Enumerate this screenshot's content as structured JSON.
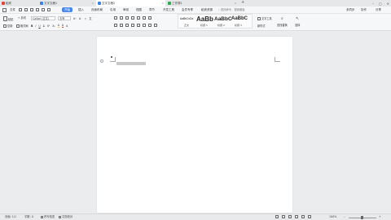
{
  "tabs": [
    {
      "label": "稻壳",
      "color": "#e2453c"
    },
    {
      "label": "文字文稿1",
      "color": "#3f7fe0"
    },
    {
      "label": "文字文稿2",
      "color": "#3f7fe0"
    },
    {
      "label": "工作簿1",
      "color": "#2ea94f"
    }
  ],
  "new_tab_icon": "plus-icon",
  "window_controls": [
    "minimize-icon",
    "maximize-icon",
    "close-icon"
  ],
  "menu": {
    "file": "文件",
    "start": "开始",
    "insert": "插入",
    "page_layout": "页面布局",
    "references": "引用",
    "review": "审阅",
    "view": "视图",
    "chapter": "章节",
    "dev_tools": "开发工具",
    "member": "会员专享",
    "docs_helper": "稻壳资源",
    "search_placeholder": "查找命令、搜索模板",
    "unsynced": "未同步",
    "collab": "协作",
    "share": "分享",
    "active_color": "#4a86e8"
  },
  "ribbon": {
    "paste": "粘贴",
    "cut": "剪切",
    "copy": "复制",
    "format_painter": "格式刷",
    "font_name": "Calibri (正文)",
    "font_size": "五号",
    "bold": "B",
    "italic": "I",
    "underline": "U",
    "styles": [
      {
        "preview": "AaBbCcDd",
        "label": "正文"
      },
      {
        "preview": "AaBb",
        "label": "标题 1"
      },
      {
        "preview": "AaBbC",
        "label": "标题 2"
      },
      {
        "preview": "AaBbC",
        "label": "标题 3"
      }
    ],
    "new_style": "新样式",
    "text_tools": "文字工具",
    "find_replace": "查找替换",
    "select": "选择"
  },
  "document": {
    "text_highlight_color": "#c8c8c8"
  },
  "status": {
    "page": "页面: 1/1",
    "words": "字数: 0",
    "spell": "拼写检查",
    "doc_check": "文档校对",
    "zoom": "100%"
  }
}
